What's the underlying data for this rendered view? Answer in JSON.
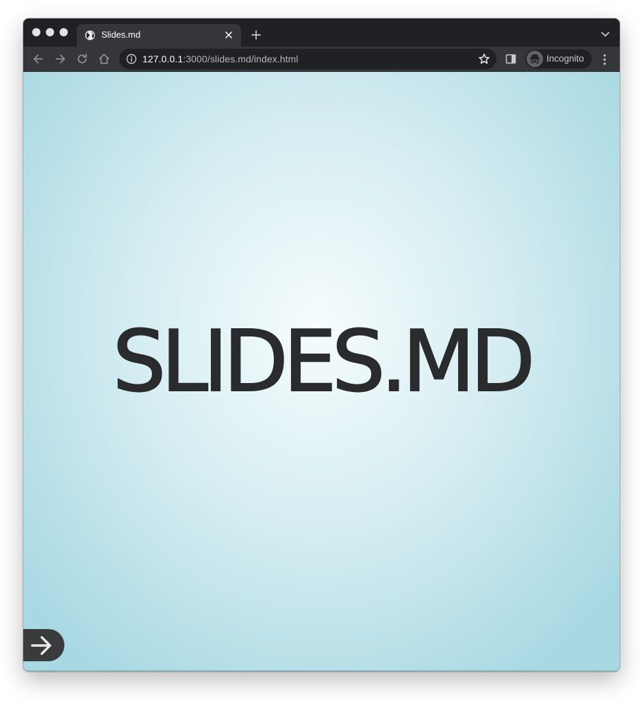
{
  "browser": {
    "tab": {
      "title": "Slides.md",
      "favicon": "globe-icon"
    },
    "toolbar": {
      "url_host": "127.0.0.1",
      "url_rest": ":3000/slides.md/index.html",
      "profile_label": "Incognito"
    },
    "icons": {
      "back": "arrow-left-icon",
      "forward": "arrow-right-icon",
      "reload": "reload-icon",
      "home": "home-icon",
      "info": "info-icon",
      "bookmark": "star-icon",
      "side_panel": "side-panel-icon",
      "incognito": "incognito-icon",
      "menu": "kebab-menu-icon",
      "new_tab": "plus-icon",
      "tab_search": "chevron-down-icon",
      "close_tab": "close-icon"
    }
  },
  "slide": {
    "title": "SLIDES.MD",
    "next_icon": "arrow-right-icon"
  },
  "colors": {
    "tabstrip": "#202124",
    "toolbar": "#35363a",
    "slide_center": "#f6fcfd",
    "slide_edge": "#a8d8e2",
    "title_text": "#2a2b2d",
    "next_button": "#3a3b3d"
  }
}
